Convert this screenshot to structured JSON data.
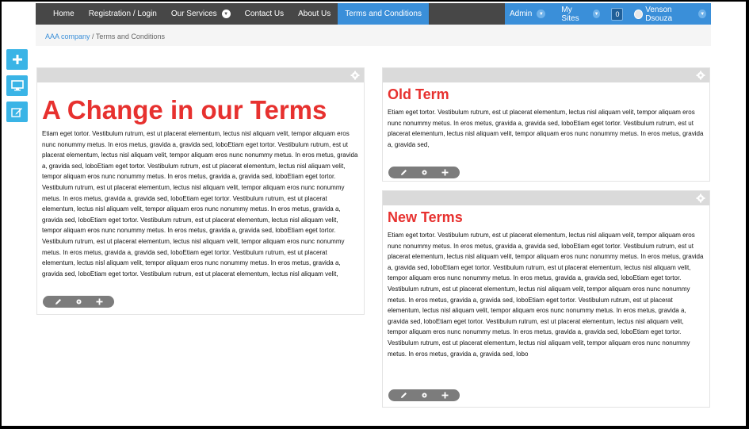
{
  "nav": {
    "items": [
      "Home",
      "Registration / Login",
      "Our Services",
      "Contact Us",
      "About Us",
      "Terms and Conditions"
    ],
    "active_index": 5,
    "admin_label": "Admin",
    "my_sites_label": "My Sites",
    "notification_count": "0",
    "user_name": "Venson Dsouza"
  },
  "breadcrumb": {
    "root": "AAA company",
    "separator": "/",
    "current": "Terms and Conditions"
  },
  "colors": {
    "accent": "#3a8fd9",
    "title_red": "#e7312f",
    "tool_blue": "#3ab4e6",
    "nav_dark": "#474747"
  },
  "panels": {
    "main": {
      "title": "A Change in our Terms",
      "body": "Etiam eget tortor. Vestibulum rutrum, est ut placerat elementum, lectus nisl aliquam velit, tempor aliquam eros nunc nonummy metus. In eros metus, gravida a, gravida sed, loboEtiam eget tortor. Vestibulum rutrum, est ut placerat elementum, lectus nisl aliquam velit, tempor aliquam eros nunc nonummy metus. In eros metus, gravida a, gravida sed, loboEtiam eget tortor. Vestibulum rutrum, est ut placerat elementum, lectus nisl aliquam velit, tempor aliquam eros nunc nonummy metus. In eros metus, gravida a, gravida sed, loboEtiam eget tortor. Vestibulum rutrum, est ut placerat elementum, lectus nisl aliquam velit, tempor aliquam eros nunc nonummy metus. In eros metus, gravida a, gravida sed, loboEtiam eget tortor. Vestibulum rutrum, est ut placerat elementum, lectus nisl aliquam velit, tempor aliquam eros nunc nonummy metus. In eros metus, gravida a, gravida sed, loboEtiam eget tortor. Vestibulum rutrum, est ut placerat elementum, lectus nisl aliquam velit, tempor aliquam eros nunc nonummy metus. In eros metus, gravida a, gravida sed, loboEtiam eget tortor. Vestibulum rutrum, est ut placerat elementum, lectus nisl aliquam velit, tempor aliquam eros nunc nonummy metus. In eros metus, gravida a, gravida sed, loboEtiam eget tortor. Vestibulum rutrum, est ut placerat elementum, lectus nisl aliquam velit, tempor aliquam eros nunc nonummy metus. In eros metus, gravida a, gravida sed, loboEtiam eget tortor. Vestibulum rutrum, est ut placerat elementum, lectus nisl aliquam velit, tempor aliquam eros nunc nonummy metus. In eros metus, gravida a, gravida sed, lobo"
    },
    "old": {
      "title": "Old Term",
      "body": "Etiam eget tortor. Vestibulum rutrum, est ut placerat elementum, lectus nisl aliquam velit, tempor aliquam eros nunc nonummy metus. In eros metus, gravida a, gravida sed, loboEtiam eget tortor. Vestibulum rutrum, est ut placerat elementum, lectus nisl aliquam velit, tempor aliquam eros nunc nonummy metus. In eros metus, gravida a, gravida sed,"
    },
    "new": {
      "title": "New Terms",
      "body": "Etiam eget tortor. Vestibulum rutrum, est ut placerat elementum, lectus nisl aliquam velit, tempor aliquam eros nunc nonummy metus. In eros metus, gravida a, gravida sed, loboEtiam eget tortor. Vestibulum rutrum, est ut placerat elementum, lectus nisl aliquam velit, tempor aliquam eros nunc nonummy metus. In eros metus, gravida a, gravida sed, loboEtiam eget tortor. Vestibulum rutrum, est ut placerat elementum, lectus nisl aliquam velit, tempor aliquam eros nunc nonummy metus. In eros metus, gravida a, gravida sed, loboEtiam eget tortor. Vestibulum rutrum, est ut placerat elementum, lectus nisl aliquam velit, tempor aliquam eros nunc nonummy metus. In eros metus, gravida a, gravida sed, loboEtiam eget tortor. Vestibulum rutrum, est ut placerat elementum, lectus nisl aliquam velit, tempor aliquam eros nunc nonummy metus. In eros metus, gravida a, gravida sed, loboEtiam eget tortor. Vestibulum rutrum, est ut placerat elementum, lectus nisl aliquam velit, tempor aliquam eros nunc nonummy metus. In eros metus, gravida a, gravida sed, loboEtiam eget tortor. Vestibulum rutrum, est ut placerat elementum, lectus nisl aliquam velit, tempor aliquam eros nunc nonummy metus. In eros metus, gravida a, gravida sed, lobo"
    }
  },
  "icons": {
    "tools": [
      "plus-icon",
      "monitor-icon",
      "edit-icon"
    ],
    "panel_actions": [
      "pencil-icon",
      "gear-icon",
      "plus-icon"
    ]
  }
}
